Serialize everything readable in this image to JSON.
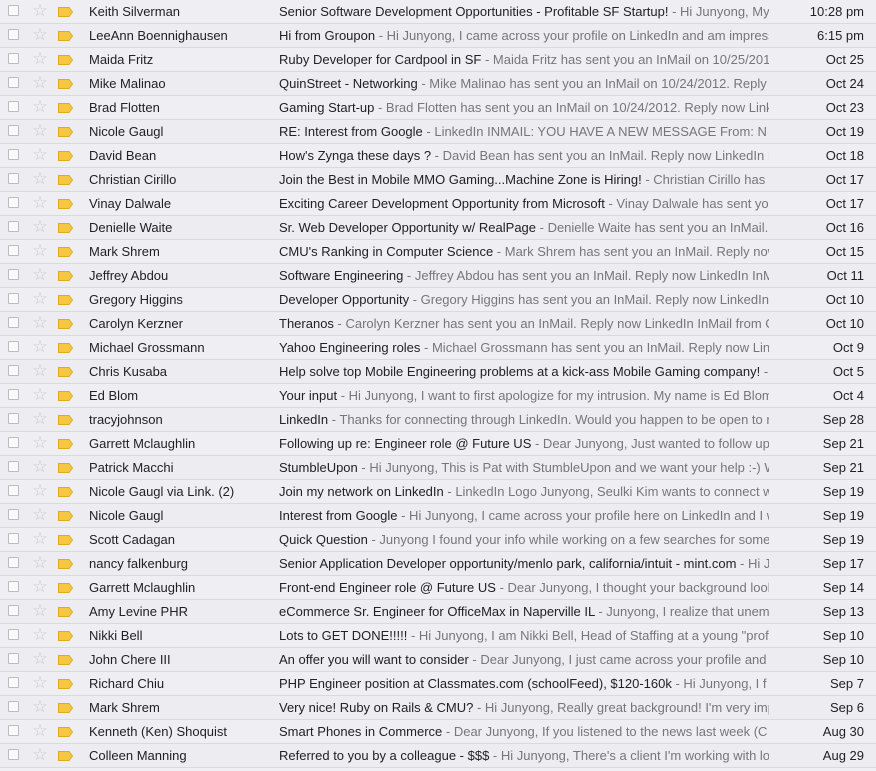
{
  "icons": {
    "checkbox": "checkbox-icon",
    "star": "star-icon",
    "label": "important-label-icon"
  },
  "colors": {
    "row_background": "#ececf1",
    "label_yellow": "#f5c842",
    "star_gray": "#c8c8c8",
    "snippet_gray": "#777777"
  },
  "emails": [
    {
      "sender": "Keith Silverman",
      "subject": "Senior Software Development Opportunities - Profitable SF Startup!",
      "snippet": " - Hi Junyong, My",
      "date": "10:28 pm"
    },
    {
      "sender": "LeeAnn Boennighausen",
      "subject": "Hi from Groupon",
      "snippet": " - Hi Junyong, I came across your profile on LinkedIn and am impress",
      "date": "6:15 pm"
    },
    {
      "sender": "Maida Fritz",
      "subject": "Ruby Developer for Cardpool in SF",
      "snippet": " - Maida Fritz has sent you an InMail on 10/25/2012",
      "date": "Oct 25"
    },
    {
      "sender": "Mike Malinao",
      "subject": "QuinStreet - Networking",
      "snippet": " - Mike Malinao has sent you an InMail on 10/24/2012. Reply",
      "date": "Oct 24"
    },
    {
      "sender": "Brad Flotten",
      "subject": "Gaming Start-up",
      "snippet": " - Brad Flotten has sent you an InMail on 10/24/2012. Reply now LinkedIn",
      "date": "Oct 23"
    },
    {
      "sender": "Nicole Gaugl",
      "subject": "RE: Interest from Google",
      "snippet": " - LinkedIn INMAIL: YOU HAVE A NEW MESSAGE From: N",
      "date": "Oct 19"
    },
    {
      "sender": "David Bean",
      "subject": "How's Zynga these days ?",
      "snippet": " - David Bean has sent you an InMail. Reply now LinkedIn I",
      "date": "Oct 18"
    },
    {
      "sender": "Christian Cirillo",
      "subject": "Join the Best in Mobile MMO Gaming...Machine Zone is Hiring!",
      "snippet": " - Christian Cirillo has",
      "date": "Oct 17"
    },
    {
      "sender": "Vinay Dalwale",
      "subject": "Exciting Career Development Opportunity from Microsoft",
      "snippet": " - Vinay Dalwale has sent you",
      "date": "Oct 17"
    },
    {
      "sender": "Denielle Waite",
      "subject": "Sr. Web Developer Opportunity w/ RealPage",
      "snippet": " - Denielle Waite has sent you an InMail.",
      "date": "Oct 16"
    },
    {
      "sender": "Mark Shrem",
      "subject": "CMU's Ranking in Computer Science",
      "snippet": " - Mark Shrem has sent you an InMail. Reply now",
      "date": "Oct 15"
    },
    {
      "sender": "Jeffrey Abdou",
      "subject": "Software Engineering",
      "snippet": " - Jeffrey Abdou has sent you an InMail. Reply now LinkedIn InMail",
      "date": "Oct 11"
    },
    {
      "sender": "Gregory Higgins",
      "subject": "Developer Opportunity",
      "snippet": " - Gregory Higgins has sent you an InMail. Reply now LinkedIn",
      "date": "Oct 10"
    },
    {
      "sender": "Carolyn Kerzner",
      "subject": "Theranos",
      "snippet": " - Carolyn Kerzner has sent you an InMail. Reply now LinkedIn InMail from C",
      "date": "Oct 10"
    },
    {
      "sender": "Michael Grossmann",
      "subject": "Yahoo Engineering roles",
      "snippet": " - Michael Grossmann has sent you an InMail. Reply now Lin",
      "date": "Oct 9"
    },
    {
      "sender": "Chris Kusaba",
      "subject": "Help solve top Mobile Engineering problems at a kick-ass Mobile Gaming company!",
      "snippet": " -",
      "date": "Oct 5"
    },
    {
      "sender": "Ed Blom",
      "subject": "Your input",
      "snippet": " - Hi Junyong, I want to first apologize for my intrusion. My name is Ed Blom",
      "date": "Oct 4"
    },
    {
      "sender": "tracyjohnson",
      "subject": "LinkedIn",
      "snippet": " - Thanks for connecting through LinkedIn. Would you happen to be open to r",
      "date": "Sep 28"
    },
    {
      "sender": "Garrett Mclaughlin",
      "subject": "Following up re: Engineer role @ Future US",
      "snippet": " - Dear Junyong, Just wanted to follow up",
      "date": "Sep 21"
    },
    {
      "sender": "Patrick Macchi",
      "subject": "StumbleUpon",
      "snippet": " - Hi Junyong, This is Pat with StumbleUpon and we want your help :-) W",
      "date": "Sep 21"
    },
    {
      "sender": "Nicole Gaugl via Link. (2)",
      "subject": "Join my network on LinkedIn",
      "snippet": " - LinkedIn Logo Junyong, Seulki Kim wants to connect w",
      "date": "Sep 19"
    },
    {
      "sender": "Nicole Gaugl",
      "subject": "Interest from Google",
      "snippet": " - Hi Junyong, I came across your profile here on LinkedIn and I w",
      "date": "Sep 19"
    },
    {
      "sender": "Scott Cadagan",
      "subject": "Quick Question",
      "snippet": " - Junyong I found your info while working on a few searches for some",
      "date": "Sep 19"
    },
    {
      "sender": "nancy falkenburg",
      "subject": "Senior Application Developer opportunity/menlo park, california/intuit - mint.com",
      "snippet": " - Hi J",
      "date": "Sep 17"
    },
    {
      "sender": "Garrett Mclaughlin",
      "subject": "Front-end Engineer role @ Future US",
      "snippet": " - Dear Junyong, I thought your background look",
      "date": "Sep 14"
    },
    {
      "sender": "Amy Levine PHR",
      "subject": "eCommerce Sr. Engineer for OfficeMax in Naperville IL",
      "snippet": " - Junyong, I realize that unemp",
      "date": "Sep 13"
    },
    {
      "sender": "Nikki Bell",
      "subject": "Lots to GET DONE!!!!!",
      "snippet": " - Hi Junyong, I am Nikki Bell, Head of Staffing at a young \"prof",
      "date": "Sep 10"
    },
    {
      "sender": "John Chere III",
      "subject": "An offer you will want to consider",
      "snippet": " - Dear Junyong, I just came across your profile and",
      "date": "Sep 10"
    },
    {
      "sender": "Richard Chiu",
      "subject": "PHP Engineer position at Classmates.com (schoolFeed), $120-160k",
      "snippet": " - Hi Junyong, I f",
      "date": "Sep 7"
    },
    {
      "sender": "Mark Shrem",
      "subject": "Very nice! Ruby on Rails & CMU?",
      "snippet": " - Hi Junyong, Really great background! I'm very imp",
      "date": "Sep 6"
    },
    {
      "sender": "Kenneth (Ken) Shoquist",
      "subject": "Smart Phones in Commerce",
      "snippet": " - Dear Junyong, If you listened to the news last week (C",
      "date": "Aug 30"
    },
    {
      "sender": "Colleen Manning",
      "subject": "Referred to you by a colleague - $$$",
      "snippet": " - Hi Junyong, There's a client I'm working with lo",
      "date": "Aug 29"
    }
  ]
}
